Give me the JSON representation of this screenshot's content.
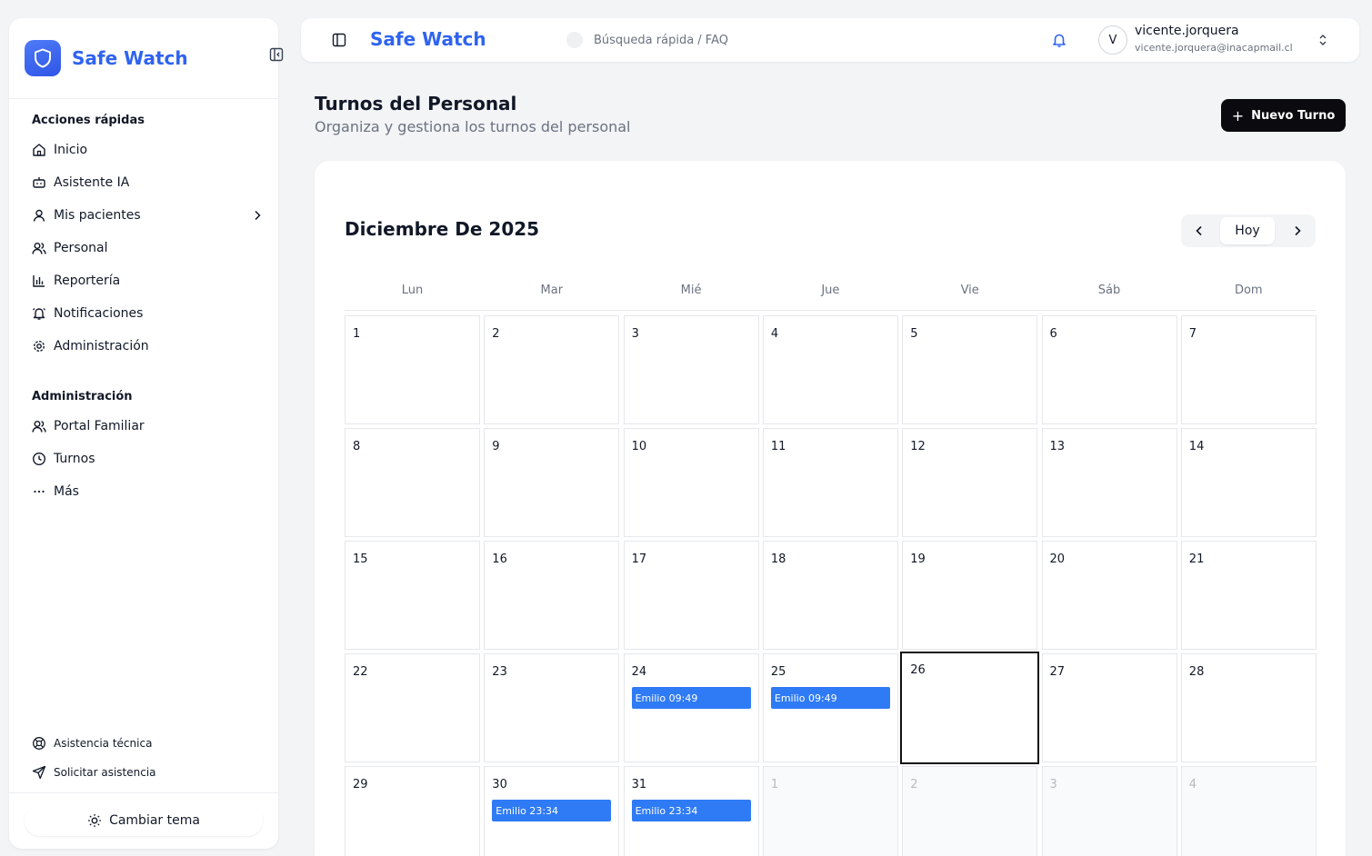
{
  "sidebar": {
    "brand": "Safe Watch",
    "quick_label": "Acciones rápidas",
    "quick_items": [
      {
        "label": "Inicio",
        "icon": "home-icon"
      },
      {
        "label": "Asistente IA",
        "icon": "bot-icon"
      },
      {
        "label": "Mis pacientes",
        "icon": "user-icon"
      },
      {
        "label": "Personal",
        "icon": "users-icon"
      },
      {
        "label": "Reportería",
        "icon": "chart-icon"
      },
      {
        "label": "Notificaciones",
        "icon": "bell-ring-icon"
      },
      {
        "label": "Administración",
        "icon": "gear-icon"
      }
    ],
    "admin_label": "Administración",
    "admin_items": [
      {
        "label": "Portal Familiar",
        "icon": "users-icon"
      },
      {
        "label": "Turnos",
        "icon": "clock-icon"
      },
      {
        "label": "Más",
        "icon": "ellipsis-icon"
      }
    ],
    "footer_items": [
      {
        "label": "Asistencia técnica",
        "icon": "lifebuoy-icon"
      },
      {
        "label": "Solicitar asistencia",
        "icon": "send-icon"
      }
    ],
    "theme_label": "Cambiar tema"
  },
  "header": {
    "brand": "Safe Watch",
    "search_label": "Búsqueda rápida / FAQ",
    "user": {
      "initial": "V",
      "name": "vicente.jorquera",
      "email": "vicente.jorquera@inacapmail.cl"
    }
  },
  "page": {
    "title": "Turnos del Personal",
    "subtitle": "Organiza y gestiona los turnos del personal",
    "new_button": "Nuevo Turno",
    "plus": "+"
  },
  "calendar": {
    "month_title": "Diciembre De 2025",
    "today_label": "Hoy",
    "weekdays": [
      "Lun",
      "Mar",
      "Mié",
      "Jue",
      "Vie",
      "Sáb",
      "Dom"
    ],
    "today_day": 26,
    "weeks": [
      [
        {
          "d": "1"
        },
        {
          "d": "2"
        },
        {
          "d": "3"
        },
        {
          "d": "4"
        },
        {
          "d": "5"
        },
        {
          "d": "6"
        },
        {
          "d": "7"
        }
      ],
      [
        {
          "d": "8"
        },
        {
          "d": "9"
        },
        {
          "d": "10"
        },
        {
          "d": "11"
        },
        {
          "d": "12"
        },
        {
          "d": "13"
        },
        {
          "d": "14"
        }
      ],
      [
        {
          "d": "15"
        },
        {
          "d": "16"
        },
        {
          "d": "17"
        },
        {
          "d": "18"
        },
        {
          "d": "19"
        },
        {
          "d": "20"
        },
        {
          "d": "21"
        }
      ],
      [
        {
          "d": "22"
        },
        {
          "d": "23"
        },
        {
          "d": "24",
          "event": "Emilio 09:49"
        },
        {
          "d": "25",
          "event": "Emilio 09:49"
        },
        {
          "d": "26",
          "today": true
        },
        {
          "d": "27"
        },
        {
          "d": "28"
        }
      ],
      [
        {
          "d": "29"
        },
        {
          "d": "30",
          "event": "Emilio 23:34"
        },
        {
          "d": "31",
          "event": "Emilio 23:34"
        },
        {
          "d": "1",
          "other": true
        },
        {
          "d": "2",
          "other": true
        },
        {
          "d": "3",
          "other": true
        },
        {
          "d": "4",
          "other": true
        }
      ]
    ]
  },
  "colors": {
    "brand": "#2f63f0",
    "event": "#2f7bf5",
    "primary_button": "#0b0b0f"
  }
}
